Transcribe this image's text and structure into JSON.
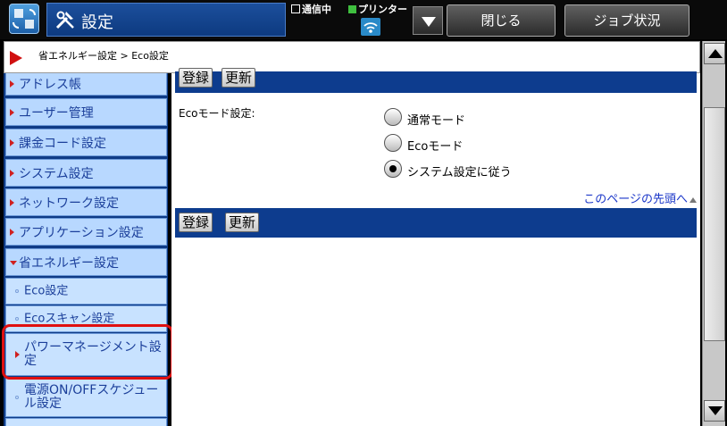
{
  "header": {
    "title": "設定",
    "status_comm": "通信中",
    "status_printer": "プリンター",
    "close_label": "閉じる",
    "job_status_label": "ジョブ状況"
  },
  "breadcrumb": "省エネルギー設定 > Eco設定",
  "sidebar": {
    "items": [
      {
        "label": "アドレス帳"
      },
      {
        "label": "ユーザー管理"
      },
      {
        "label": "課金コード設定"
      },
      {
        "label": "システム設定"
      },
      {
        "label": "ネットワーク設定"
      },
      {
        "label": "アプリケーション設定"
      },
      {
        "label": "省エネルギー設定"
      }
    ],
    "subitems": [
      {
        "label": "Eco設定"
      },
      {
        "label": "Ecoスキャン設定"
      },
      {
        "label": "パワーマネージメント設定"
      },
      {
        "label": "電源ON/OFFスケジュール設定"
      }
    ]
  },
  "main": {
    "register_label": "登録",
    "update_label": "更新",
    "eco_mode_label": "Ecoモード設定:",
    "options": [
      {
        "label": "通常モード",
        "selected": false
      },
      {
        "label": "Ecoモード",
        "selected": false
      },
      {
        "label": "システム設定に従う",
        "selected": true
      }
    ],
    "page_top_link": "このページの先頭へ"
  },
  "colors": {
    "nav_blue": "#0d3c8e",
    "sidebar_item": "#b8d8ff",
    "highlight_ring": "#e01010",
    "link": "#1a36c8"
  }
}
